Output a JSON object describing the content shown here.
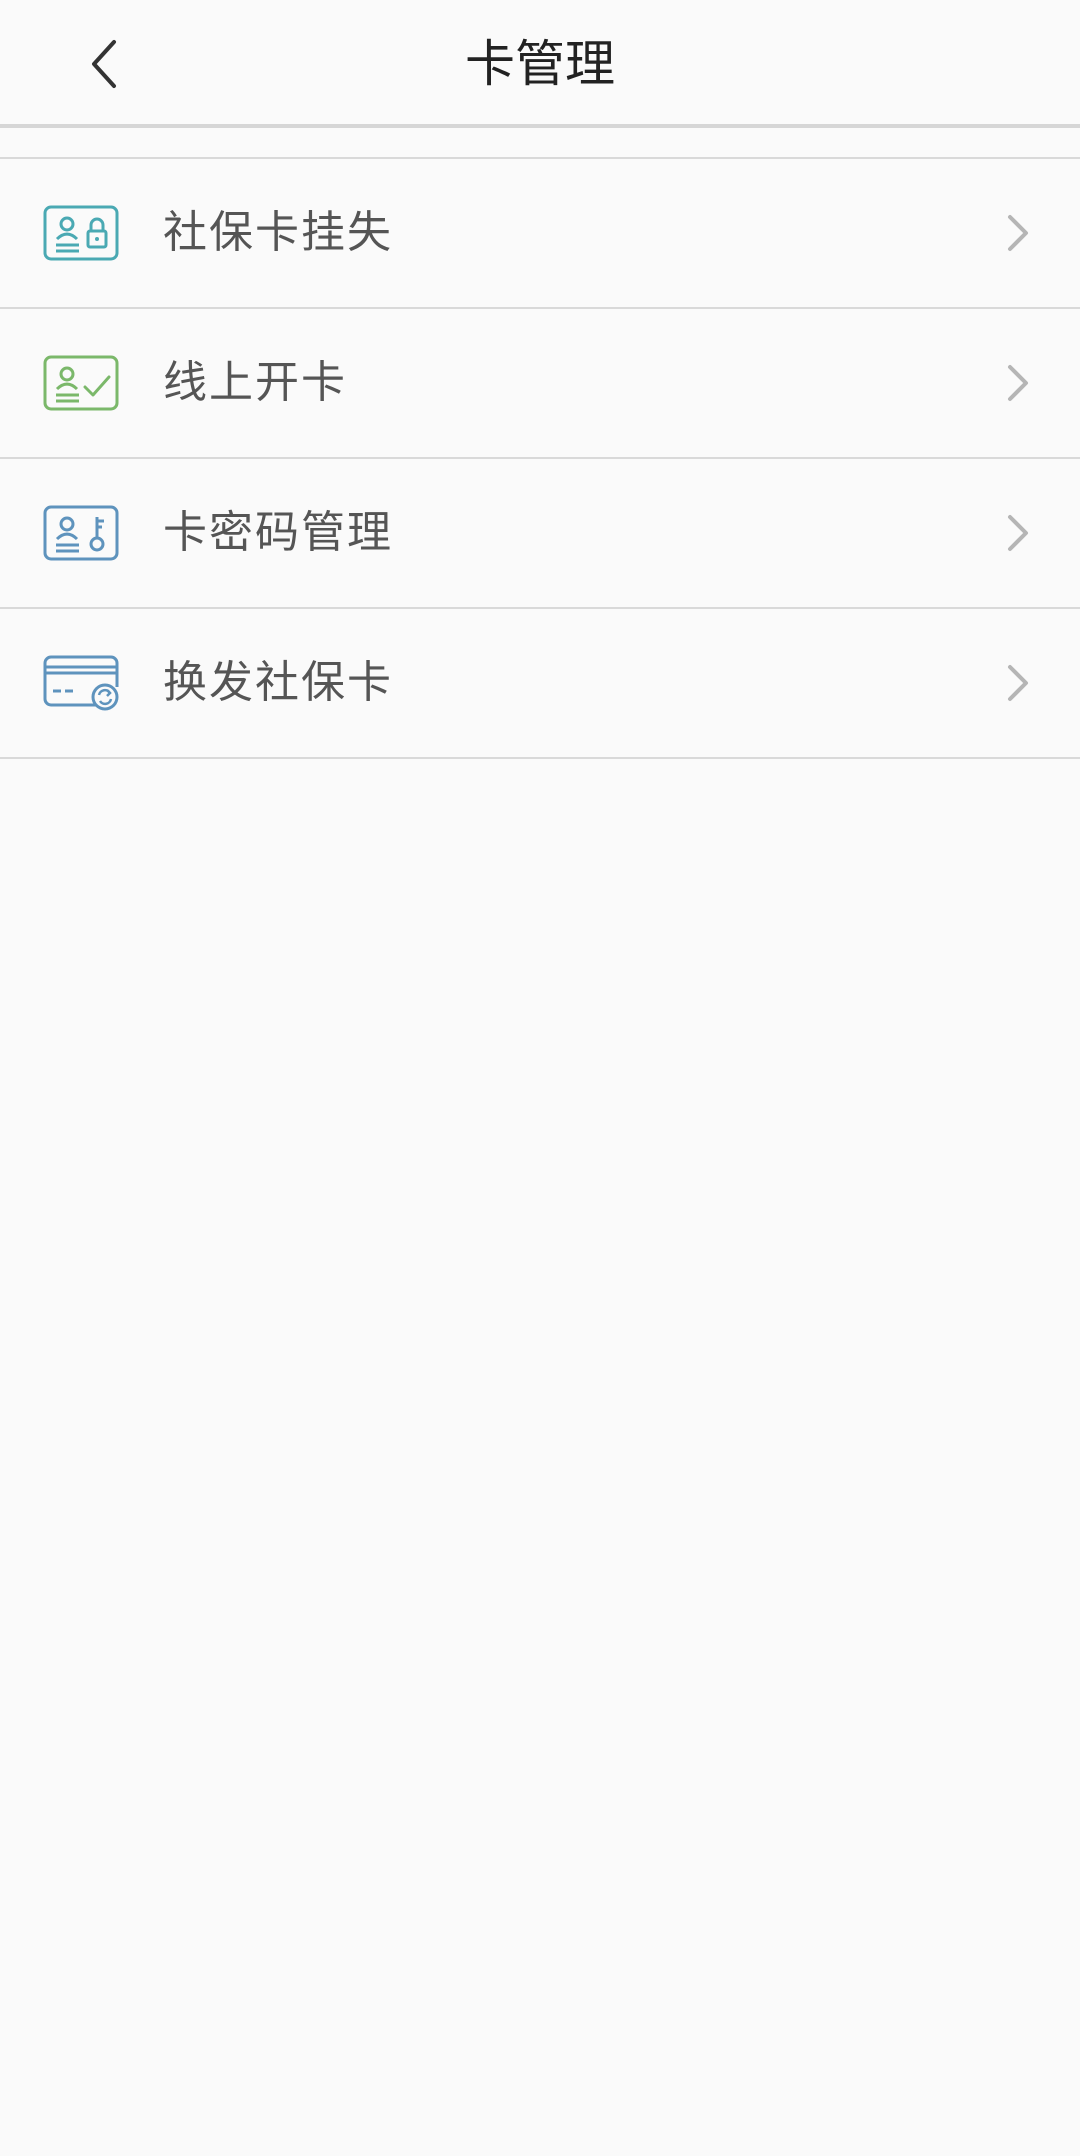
{
  "header": {
    "title": "卡管理"
  },
  "menu": {
    "items": [
      {
        "label": "社保卡挂失",
        "icon": "card-lock-icon",
        "color": "#4aa9b3"
      },
      {
        "label": "线上开卡",
        "icon": "card-check-icon",
        "color": "#7bb86a"
      },
      {
        "label": "卡密码管理",
        "icon": "card-key-icon",
        "color": "#5e93bd"
      },
      {
        "label": "换发社保卡",
        "icon": "card-refresh-icon",
        "color": "#5e93bd"
      }
    ]
  },
  "colors": {
    "background": "#fafafa",
    "divider": "#d9d9d9",
    "chevron": "#b5b5b5",
    "text": "#555555",
    "title": "#222222"
  }
}
